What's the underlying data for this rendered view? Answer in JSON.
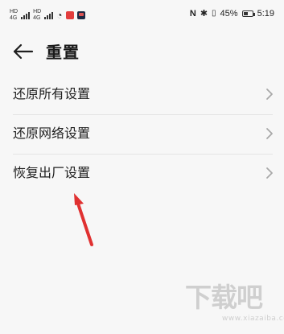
{
  "status_bar": {
    "left_badges": [
      "HD",
      "HD"
    ],
    "network_labels": [
      "4G",
      "4G"
    ],
    "battery_percent": "45%",
    "battery_level": 0.45,
    "time": "5:19"
  },
  "header": {
    "title": "重置"
  },
  "settings": {
    "items": [
      {
        "label": "还原所有设置"
      },
      {
        "label": "还原网络设置"
      },
      {
        "label": "恢复出厂设置"
      }
    ]
  },
  "annotation": {
    "color": "#e03131"
  },
  "watermark": {
    "text": "下载吧",
    "subtext": "www.xiazaiba.com"
  }
}
